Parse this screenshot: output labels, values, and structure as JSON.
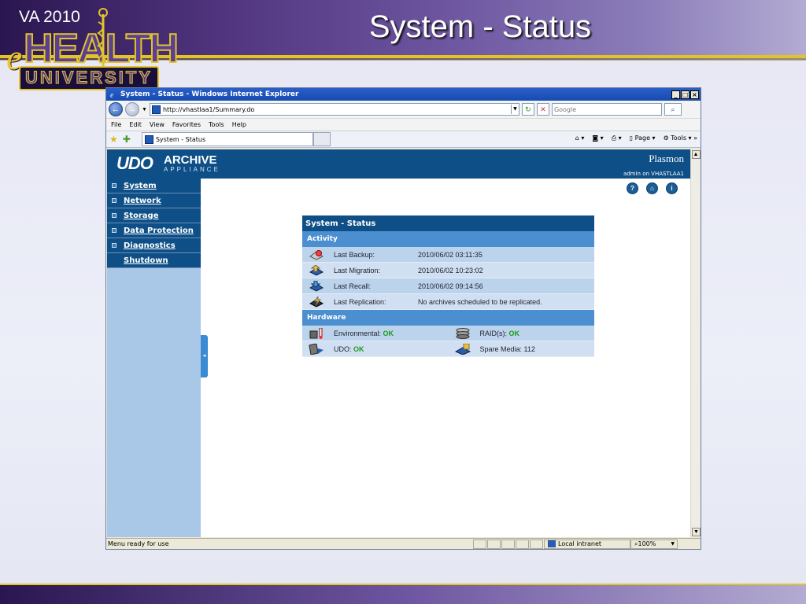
{
  "slide": {
    "title": "System - Status",
    "logo": {
      "va": "VA 2010",
      "e": "e",
      "health": "HEALTH",
      "university": "UNIVERSITY"
    }
  },
  "browser": {
    "window_title": "System - Status - Windows Internet Explorer",
    "address": "http://vhastlaa1/Summary.do",
    "search_placeholder": "Google",
    "menu": [
      "File",
      "Edit",
      "View",
      "Favorites",
      "Tools",
      "Help"
    ],
    "tab_title": "System - Status",
    "commands": {
      "page": "Page",
      "tools": "Tools"
    },
    "status_text": "Menu ready for use",
    "zone": "Local intranet",
    "zoom": "100%"
  },
  "app": {
    "logo_udo": "UDO",
    "logo_archive": "ARCHIVE",
    "logo_appliance": "APPLIANCE",
    "brand": "Plasmon",
    "user_info": "admin on VHASTLAA1",
    "nav": [
      {
        "label": "System"
      },
      {
        "label": "Network"
      },
      {
        "label": "Storage"
      },
      {
        "label": "Data Protection"
      },
      {
        "label": "Diagnostics"
      },
      {
        "label": "Shutdown"
      }
    ],
    "panel": {
      "title": "System - Status",
      "activity_header": "Activity",
      "activity": [
        {
          "label": "Last Backup:",
          "value": "2010/06/02 03:11:35"
        },
        {
          "label": "Last Migration:",
          "value": "2010/06/02 10:23:02"
        },
        {
          "label": "Last Recall:",
          "value": "2010/06/02 09:14:56"
        },
        {
          "label": "Last Replication:",
          "value": "No archives scheduled to be replicated."
        }
      ],
      "hardware_header": "Hardware",
      "hardware": {
        "environmental_label": "Environmental:",
        "environmental_value": "OK",
        "raid_label": "RAID(s):",
        "raid_value": "OK",
        "udo_label": "UDO:",
        "udo_value": "OK",
        "spare_label": "Spare Media:",
        "spare_value": "112"
      }
    }
  },
  "colors": {
    "header_blue": "#0d4f86",
    "section_blue": "#4c8fd0",
    "ok_green": "#1b9a1b",
    "slide_gold": "#e2c42a"
  }
}
